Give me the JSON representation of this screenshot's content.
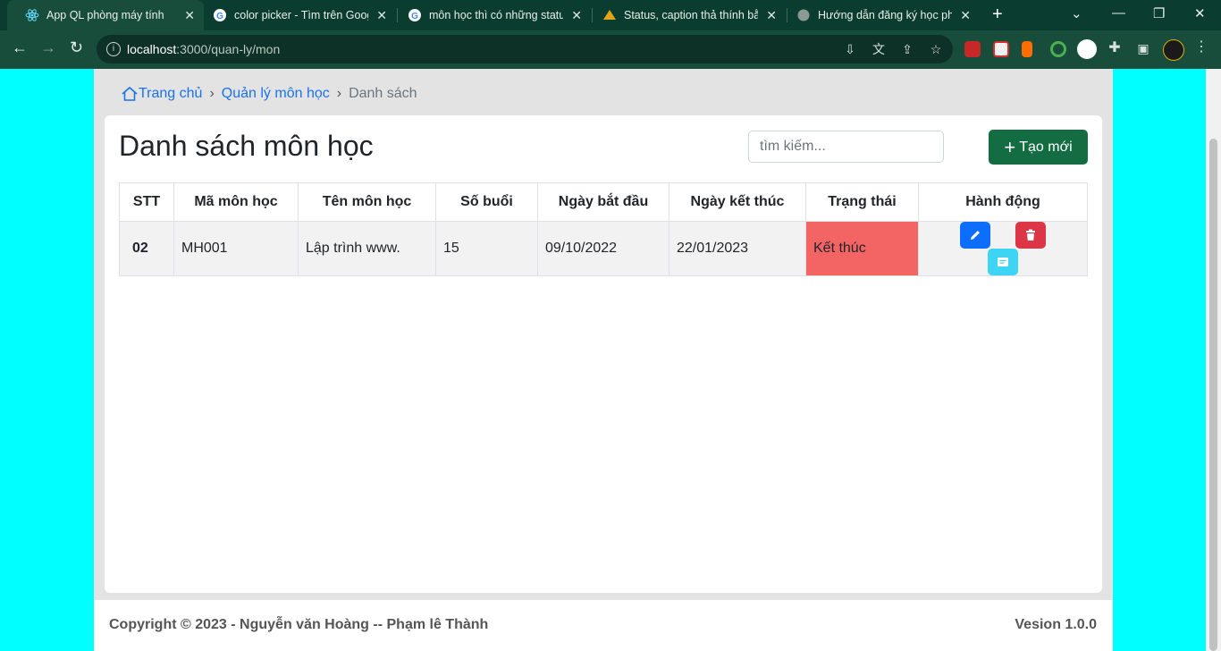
{
  "browser": {
    "tabs": [
      {
        "title": "App QL phòng máy tính",
        "icon": "react-icon",
        "active": true
      },
      {
        "title": "color picker - Tìm trên Goog",
        "icon": "google-icon"
      },
      {
        "title": "môn học thì có những status",
        "icon": "google-icon"
      },
      {
        "title": "Status, caption thả thính bằ",
        "icon": "site-icon"
      },
      {
        "title": "Hướng dẫn đăng ký học phí",
        "icon": "globe-icon"
      }
    ],
    "url_host": "localhost",
    "url_path": ":3000/quan-ly/mon"
  },
  "breadcrumb": {
    "home": "Trang chủ",
    "section": "Quản lý môn học",
    "current": "Danh sách"
  },
  "main": {
    "title": "Danh sách môn học",
    "search_placeholder": "tìm kiếm...",
    "create_label": "Tạo mới"
  },
  "table": {
    "headers": [
      "STT",
      "Mã môn học",
      "Tên môn học",
      "Số buổi",
      "Ngày bắt đầu",
      "Ngày kết thúc",
      "Trạng thái",
      "Hành động"
    ],
    "rows": [
      {
        "stt": "02",
        "code": "MH001",
        "name": "Lập trình www.",
        "sessions": "15",
        "start": "09/10/2022",
        "end": "22/01/2023",
        "status": "Kết thúc"
      }
    ]
  },
  "footer": {
    "copyright": "Copyright © 2023 - Nguyễn văn Hoàng -- Phạm lê Thành",
    "version": "Vesion 1.0.0"
  },
  "colors": {
    "background": "#00ffff",
    "create_button": "#146c43",
    "status_ended": "#f36565",
    "edit": "#0d6efd",
    "delete": "#dc3545",
    "detail": "#3dd5f3"
  }
}
